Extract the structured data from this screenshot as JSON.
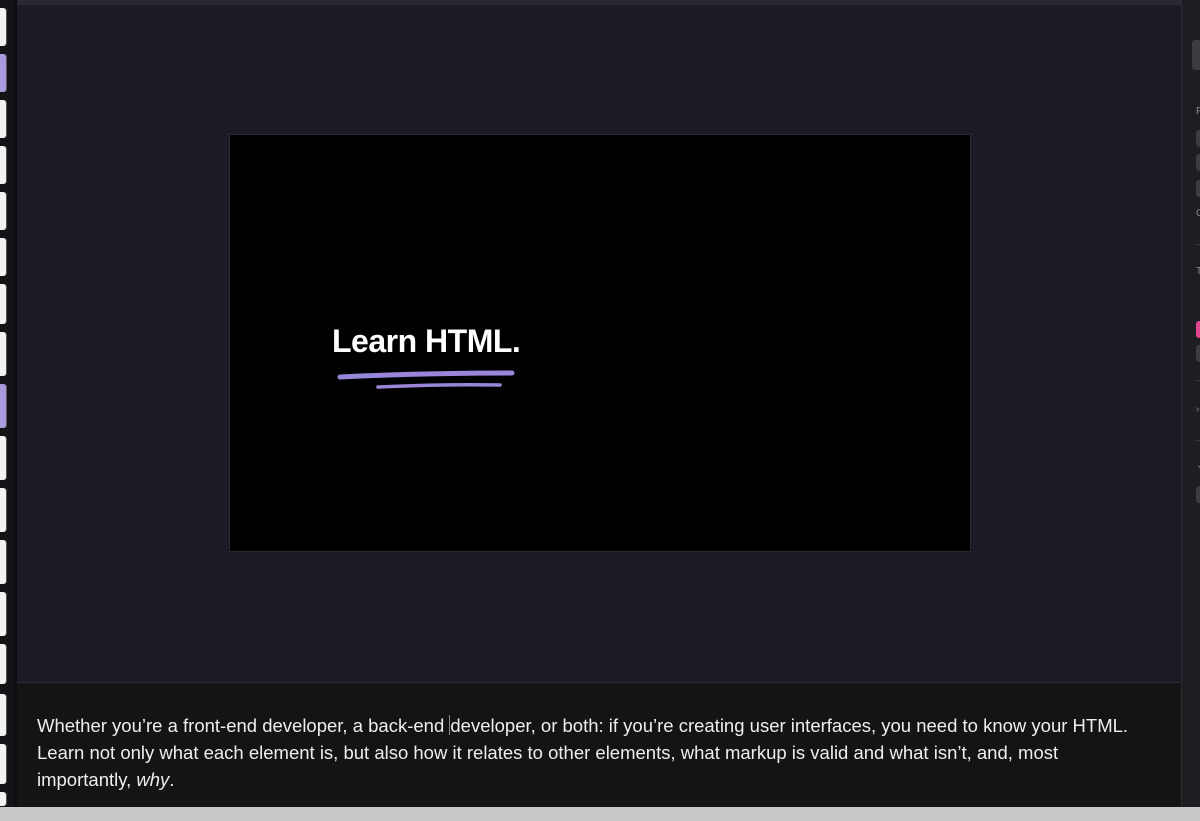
{
  "slide": {
    "title": "Learn HTML.",
    "accent_color": "#9a86d8"
  },
  "notes": {
    "part1": "Whether you’re a front-end developer, a back-end ",
    "part2": "developer, or both: if you’re creating user interfaces, you need to know your HTML. Learn not only what each element is, but also how it relates to other elements, what markup is valid and what isn’t, and, most importantly, ",
    "emphasis": "why",
    "end": "."
  },
  "right_panel": {
    "labels": [
      "F",
      "C",
      "T"
    ]
  }
}
